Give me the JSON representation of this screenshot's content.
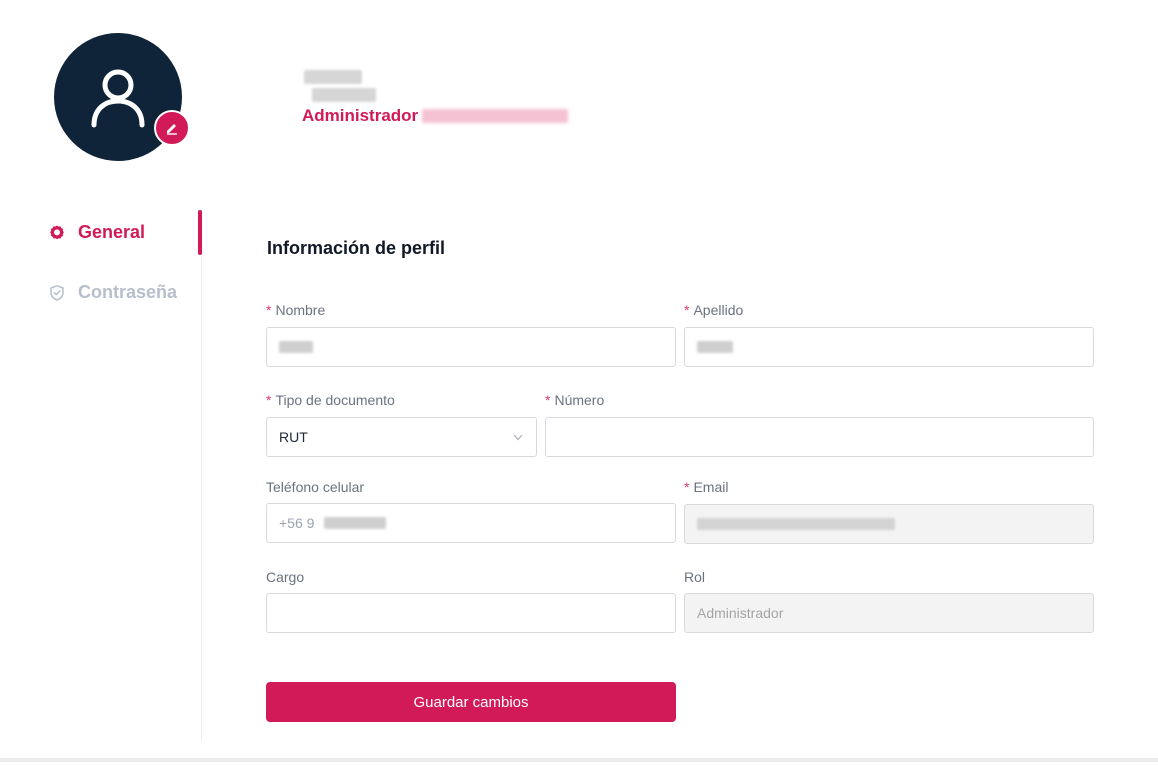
{
  "header": {
    "role_label": "Administrador"
  },
  "sidebar": {
    "items": [
      {
        "label": "General",
        "icon": "gear-icon",
        "active": true
      },
      {
        "label": "Contraseña",
        "icon": "shield-check-icon",
        "active": false
      }
    ]
  },
  "form": {
    "title": "Información de perfil",
    "nombre": {
      "label": "Nombre",
      "required": "*"
    },
    "apellido": {
      "label": "Apellido",
      "required": "*"
    },
    "tipo_documento": {
      "label": "Tipo de documento",
      "required": "*",
      "value": "RUT"
    },
    "numero": {
      "label": "Número",
      "required": "*",
      "value": ""
    },
    "telefono": {
      "label": "Teléfono celular",
      "prefix": "+56 9"
    },
    "email": {
      "label": "Email",
      "required": "*"
    },
    "cargo": {
      "label": "Cargo",
      "value": ""
    },
    "rol": {
      "label": "Rol",
      "value": "Administrador"
    },
    "save_label": "Guardar cambios"
  },
  "colors": {
    "accent": "#d11a57",
    "avatar_bg": "#0f2438",
    "muted": "#b8bfcc"
  }
}
